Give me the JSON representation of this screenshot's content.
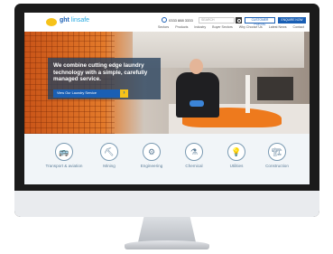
{
  "header": {
    "logo_mark": "ght",
    "logo_text": "linsafe",
    "phone": "0333 888 3333",
    "search_placeholder": "SEARCH",
    "customer_portal": "CUSTOMER PORTAL",
    "enquire_now": "ENQUIRE NOW"
  },
  "nav": {
    "items": [
      "Sectors",
      "Products",
      "Industry",
      "Buyer Sectors",
      "Why Choose Us",
      "Latest News",
      "Contact"
    ]
  },
  "hero": {
    "title": "We combine cutting edge laundry technology with a simple, carefully managed service.",
    "cta_label": "View Our Laundry Service",
    "cta_arrow": "›"
  },
  "sectors": [
    {
      "label": "Transport & aviation",
      "icon": "bus-icon",
      "glyph": "🚌"
    },
    {
      "label": "Mining",
      "icon": "pickaxe-icon",
      "glyph": "⛏"
    },
    {
      "label": "Engineering",
      "icon": "gears-icon",
      "glyph": "⚙"
    },
    {
      "label": "Chemical",
      "icon": "flask-icon",
      "glyph": "⚗"
    },
    {
      "label": "Utilities",
      "icon": "lightbulb-icon",
      "glyph": "💡"
    },
    {
      "label": "Construction",
      "icon": "crane-icon",
      "glyph": "🏗"
    }
  ],
  "colors": {
    "brand_blue": "#1a5fb4",
    "brand_yellow": "#f6c21a",
    "hero_orange": "#e37a2a"
  }
}
